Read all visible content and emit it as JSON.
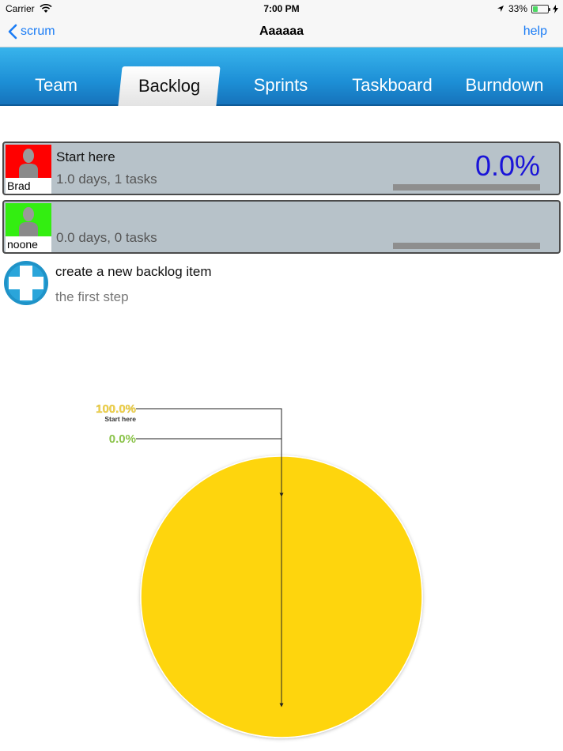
{
  "status_bar": {
    "carrier": "Carrier",
    "time": "7:00 PM",
    "battery": "33%",
    "battery_level": 0.33
  },
  "nav": {
    "back_label": "scrum",
    "title": "Aaaaaa",
    "help_label": "help"
  },
  "tabs": [
    {
      "label": "Team",
      "active": false
    },
    {
      "label": "Backlog",
      "active": true
    },
    {
      "label": "Sprints",
      "active": false
    },
    {
      "label": "Taskboard",
      "active": false
    },
    {
      "label": "Burndown",
      "active": false
    }
  ],
  "backlog": [
    {
      "owner": "Brad",
      "owner_color": "#ff0000",
      "title": "Start here",
      "subtitle": "1.0 days, 1 tasks",
      "percent_label": "0.0%",
      "progress": 0.0
    },
    {
      "owner": "noone",
      "owner_color": "#33ee11",
      "title": "",
      "subtitle": "0.0 days, 0 tasks",
      "percent_label": "",
      "progress": 0.0
    }
  ],
  "create_item": {
    "title": "create a new backlog item",
    "subtitle": "the first step"
  },
  "colors": {
    "accent": "#1a7cf5",
    "tab_gradient_top": "#38b4ec",
    "pie_yellow": "#fed50a",
    "callout_yellow": "#f2d24a",
    "callout_green": "#8bc34a"
  },
  "chart_data": {
    "type": "pie",
    "slices": [
      {
        "label": "Start here",
        "value_label": "100.0%",
        "value": 100.0,
        "color": "#fed50a"
      },
      {
        "label": "",
        "value_label": "0.0%",
        "value": 0.0,
        "color": "#8bc34a"
      }
    ]
  }
}
